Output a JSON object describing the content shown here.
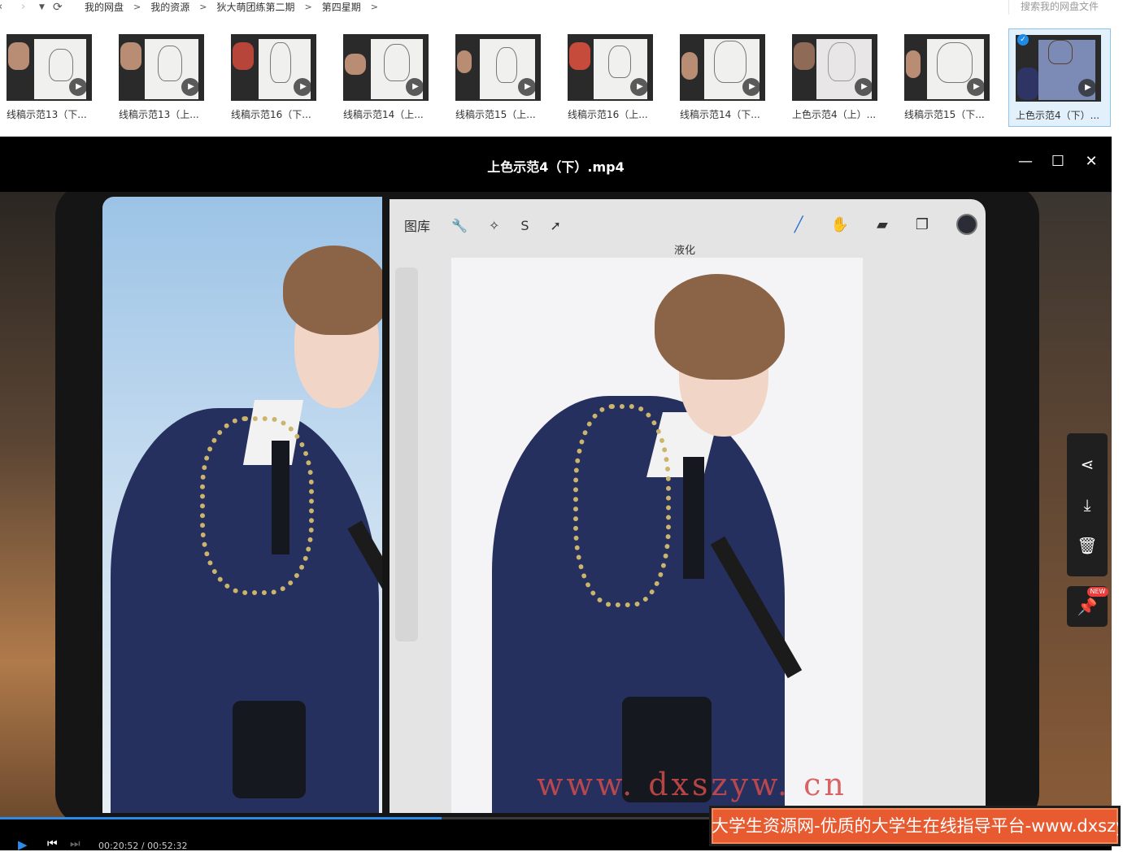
{
  "nav": {
    "back_icon": "chevron-left-icon",
    "forward_icon": "chevron-right-icon",
    "dropdown_icon": "caret-down-icon",
    "refresh_icon": "refresh-icon",
    "crumbs": [
      "我的网盘",
      "我的资源",
      "狄大萌团练第二期",
      "第四星期"
    ],
    "sep": ">",
    "search_placeholder": "搜索我的网盘文件"
  },
  "thumbnails": [
    {
      "label": "线稿示范13（下..."
    },
    {
      "label": "线稿示范13（上..."
    },
    {
      "label": "线稿示范16（下..."
    },
    {
      "label": "线稿示范14（上..."
    },
    {
      "label": "线稿示范15（上..."
    },
    {
      "label": "线稿示范16（上..."
    },
    {
      "label": "线稿示范14（下..."
    },
    {
      "label": "上色示范4（上）..."
    },
    {
      "label": "线稿示范15（下..."
    },
    {
      "label": "上色示范4（下）...",
      "selected": true
    }
  ],
  "player": {
    "title": "上色示范4（下）.mp4",
    "minimize": "—",
    "maximize": "☐",
    "close": "✕",
    "procreate": {
      "gallery": "图库",
      "liquify": "液化"
    },
    "watermark": "www. dxszyw. cn",
    "time": "00:20:52 / 00:52:32",
    "progress": 0.397
  },
  "side_actions": [
    "share-icon",
    "download-icon",
    "delete-icon"
  ],
  "pin": {
    "icon": "pin-icon",
    "badge": "NEW"
  },
  "banner": {
    "text": "大学生资源网-优质的大学生在线指导平台-www.dxszyw.cn"
  },
  "colors": {
    "accent": "#2c8ae8",
    "banner": "#e85a30"
  }
}
